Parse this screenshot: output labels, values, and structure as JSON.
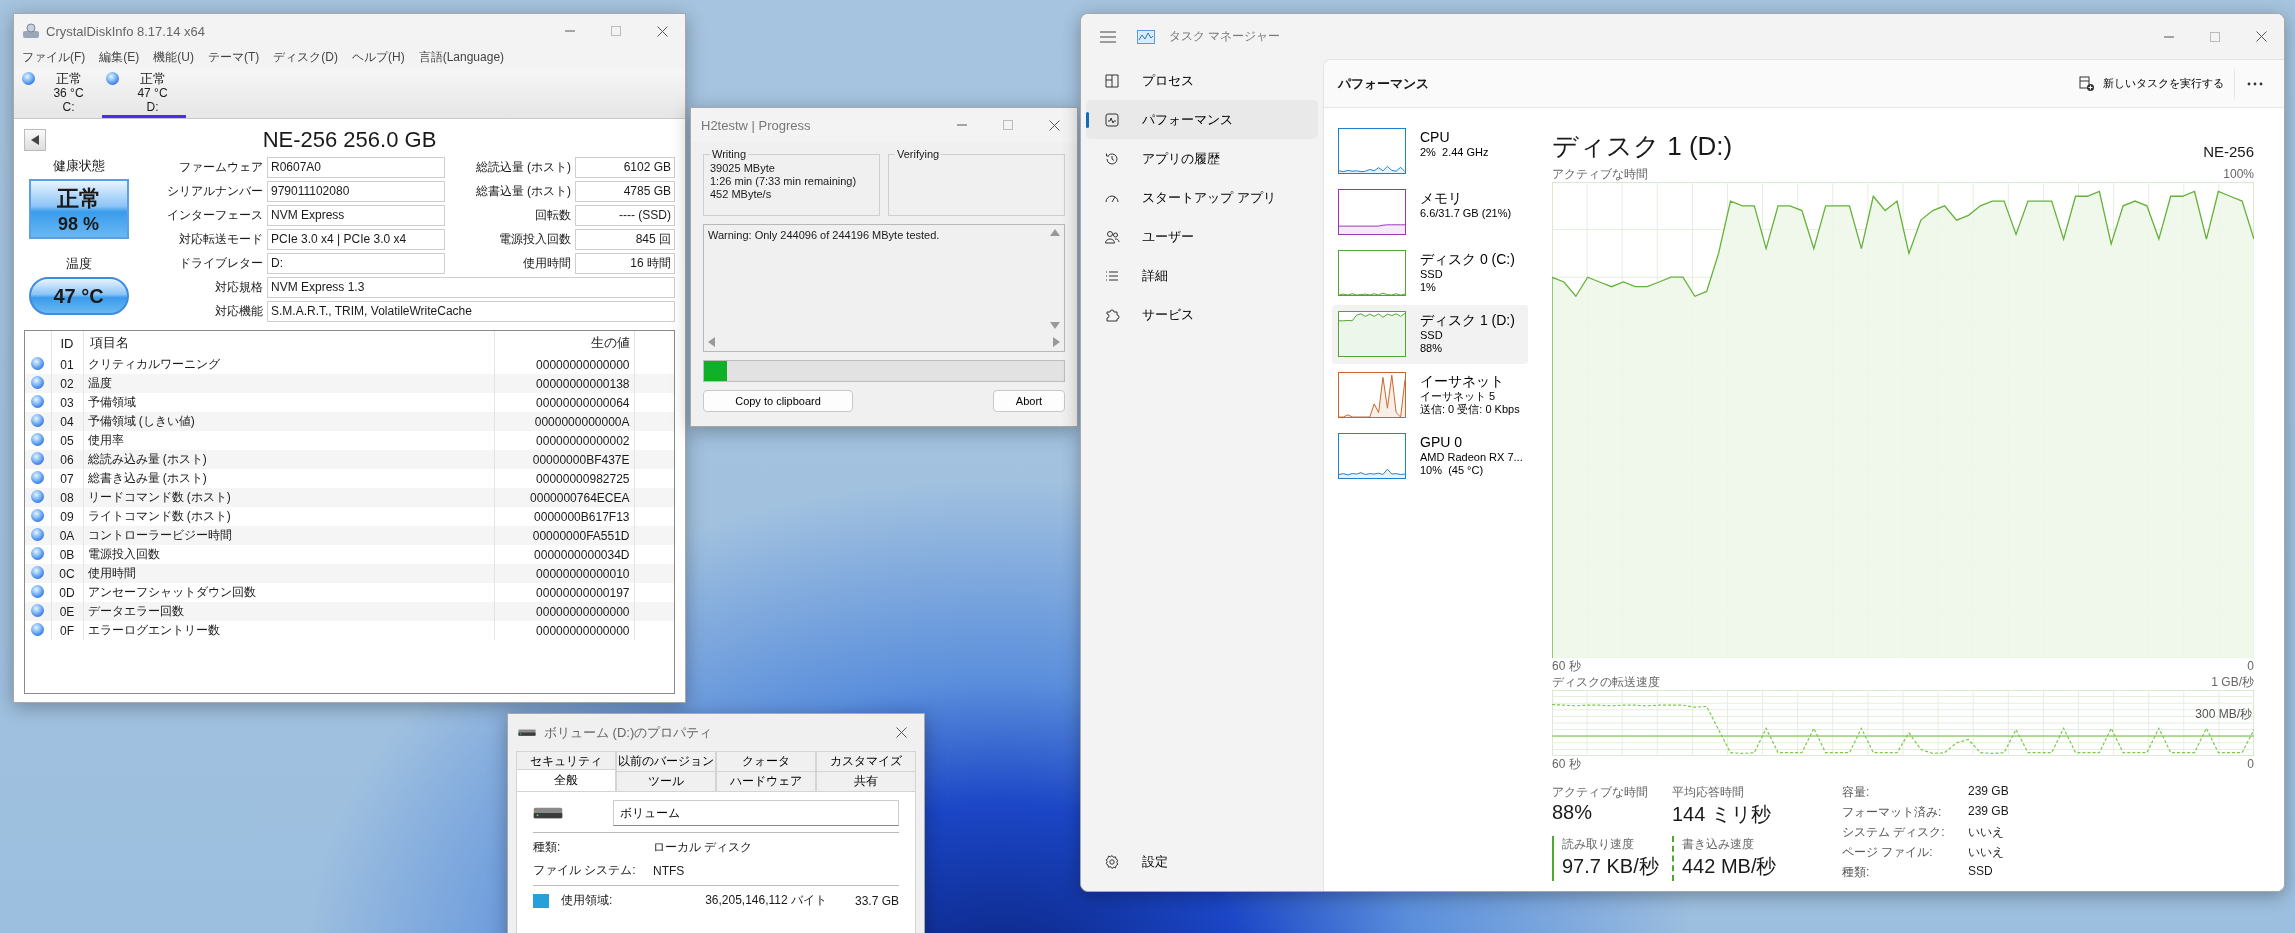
{
  "crystaldiskinfo": {
    "title": "CrystalDiskInfo 8.17.14 x64",
    "menu": [
      "ファイル(F)",
      "編集(E)",
      "機能(U)",
      "テーマ(T)",
      "ディスク(D)",
      "ヘルプ(H)",
      "言語(Language)"
    ],
    "drives": [
      {
        "status": "正常",
        "temperature": "36 °C",
        "letter": "C:",
        "selected": false
      },
      {
        "status": "正常",
        "temperature": "47 °C",
        "letter": "D:",
        "selected": true
      }
    ],
    "model": "NE-256 256.0 GB",
    "health": {
      "label": "健康状態",
      "status": "正常",
      "percent": "98 %"
    },
    "temperature": {
      "label": "温度",
      "value": "47 °C"
    },
    "info": [
      {
        "label": "ファームウェア",
        "value": "R0607A0",
        "right_label": "総読込量 (ホスト)",
        "right_value": "6102 GB"
      },
      {
        "label": "シリアルナンバー",
        "value": "979011102080",
        "right_label": "総書込量 (ホスト)",
        "right_value": "4785 GB"
      },
      {
        "label": "インターフェース",
        "value": "NVM Express",
        "right_label": "回転数",
        "right_value": "---- (SSD)"
      },
      {
        "label": "対応転送モード",
        "value": "PCIe 3.0 x4 | PCIe 3.0 x4",
        "right_label": "電源投入回数",
        "right_value": "845 回"
      },
      {
        "label": "ドライブレター",
        "value": "D:",
        "right_label": "使用時間",
        "right_value": "16 時間"
      }
    ],
    "info_wide": [
      {
        "label": "対応規格",
        "value": "NVM Express 1.3"
      },
      {
        "label": "対応機能",
        "value": "S.M.A.R.T., TRIM, VolatileWriteCache"
      }
    ],
    "smart": {
      "columns": [
        "ID",
        "項目名",
        "生の値"
      ],
      "rows": [
        {
          "id": "01",
          "name": "クリティカルワーニング",
          "raw": "00000000000000"
        },
        {
          "id": "02",
          "name": "温度",
          "raw": "00000000000138"
        },
        {
          "id": "03",
          "name": "予備領域",
          "raw": "00000000000064"
        },
        {
          "id": "04",
          "name": "予備領域 (しきい値)",
          "raw": "0000000000000A"
        },
        {
          "id": "05",
          "name": "使用率",
          "raw": "00000000000002"
        },
        {
          "id": "06",
          "name": "総読み込み量 (ホスト)",
          "raw": "00000000BF437E"
        },
        {
          "id": "07",
          "name": "総書き込み量 (ホスト)",
          "raw": "00000000982725"
        },
        {
          "id": "08",
          "name": "リードコマンド数 (ホスト)",
          "raw": "0000000764ECEA"
        },
        {
          "id": "09",
          "name": "ライトコマンド数 (ホスト)",
          "raw": "0000000B617F13"
        },
        {
          "id": "0A",
          "name": "コントローラービジー時間",
          "raw": "00000000FA551D"
        },
        {
          "id": "0B",
          "name": "電源投入回数",
          "raw": "0000000000034D"
        },
        {
          "id": "0C",
          "name": "使用時間",
          "raw": "00000000000010"
        },
        {
          "id": "0D",
          "name": "アンセーフシャットダウン回数",
          "raw": "00000000000197"
        },
        {
          "id": "0E",
          "name": "データエラー回数",
          "raw": "00000000000000"
        },
        {
          "id": "0F",
          "name": "エラーログエントリー数",
          "raw": "00000000000000"
        }
      ]
    }
  },
  "h2testw": {
    "title": "H2testw | Progress",
    "writing": {
      "label": "Writing",
      "lines": [
        "39025 MByte",
        "1:26 min (7:33 min remaining)",
        "452 MByte/s"
      ]
    },
    "verifying": {
      "label": "Verifying"
    },
    "log": "Warning: Only 244096 of 244196 MByte tested.",
    "progress": {
      "level": 0.065
    },
    "buttons": [
      "Copy to clipboard",
      "Abort"
    ]
  },
  "properties": {
    "title": "ボリューム (D:)のプロパティ",
    "tabs_back": [
      {
        "label": "セキュリティ",
        "selected": false
      },
      {
        "label": "以前のバージョン",
        "selected": false
      },
      {
        "label": "クォータ",
        "selected": false
      },
      {
        "label": "カスタマイズ",
        "selected": false
      }
    ],
    "tabs_front": [
      {
        "label": "全般",
        "selected": true
      },
      {
        "label": "ツール",
        "selected": false
      },
      {
        "label": "ハードウェア",
        "selected": false
      },
      {
        "label": "共有",
        "selected": false
      }
    ],
    "name": "ボリューム",
    "fields": [
      {
        "label": "種類:",
        "value": "ローカル ディスク"
      },
      {
        "label": "ファイル システム:",
        "value": "NTFS"
      }
    ],
    "used": {
      "label": "使用領域:",
      "bytes": "36,205,146,112 バイト",
      "size": "33.7 GB"
    }
  },
  "task_manager": {
    "title": "タスク マネージャー",
    "nav": [
      {
        "label": "プロセス",
        "selected": false
      },
      {
        "label": "パフォーマンス",
        "selected": true
      },
      {
        "label": "アプリの履歴",
        "selected": false
      },
      {
        "label": "スタートアップ アプリ",
        "selected": false
      },
      {
        "label": "ユーザー",
        "selected": false
      },
      {
        "label": "詳細",
        "selected": false
      },
      {
        "label": "サービス",
        "selected": false
      }
    ],
    "settings": "設定",
    "section_title": "パフォーマンス",
    "run_task": "新しいタスクを実行する",
    "devices": [
      {
        "name": "CPU",
        "lines": [
          "2%  2.44 GHz"
        ],
        "color": "#1f7fcf",
        "selected": false
      },
      {
        "name": "メモリ",
        "lines": [
          "6.6/31.7 GB (21%)"
        ],
        "color": "#9b34b8",
        "selected": false
      },
      {
        "name": "ディスク 0 (C:)",
        "lines": [
          "SSD",
          "1%"
        ],
        "color": "#4ea72e",
        "selected": false
      },
      {
        "name": "ディスク 1 (D:)",
        "lines": [
          "SSD",
          "88%"
        ],
        "color": "#4ea72e",
        "selected": true
      },
      {
        "name": "イーサネット",
        "lines": [
          "イーサネット 5",
          "送信: 0 受信: 0 Kbps"
        ],
        "color": "#c8662c",
        "selected": false
      },
      {
        "name": "GPU 0",
        "lines": [
          "AMD Radeon RX 7...",
          "10%  (45 °C)"
        ],
        "color": "#1f7fcf",
        "selected": false
      }
    ],
    "detail": {
      "title": "ディスク 1 (D:)",
      "model": "NE-256",
      "active_graph": {
        "label": "アクティブな時間",
        "max": "100%",
        "x_start": "60 秒",
        "x_end": "0"
      },
      "transfer_graph": {
        "label": "ディスクの転送速度",
        "max": "1 GB/秒",
        "reference": "300 MB/秒",
        "x_start": "60 秒",
        "x_end": "0"
      },
      "stats": [
        {
          "label": "アクティブな時間",
          "value": "88%"
        },
        {
          "label": "平均応答時間",
          "value": "144 ミリ秒"
        }
      ],
      "speeds": [
        {
          "label": "読み取り速度",
          "value": "97.7 KB/秒",
          "kind": "read"
        },
        {
          "label": "書き込み速度",
          "value": "442 MB/秒",
          "kind": "write"
        }
      ],
      "properties": [
        {
          "label": "容量:",
          "value": "239 GB"
        },
        {
          "label": "フォーマット済み:",
          "value": "239 GB"
        },
        {
          "label": "システム ディスク:",
          "value": "いいえ"
        },
        {
          "label": "ページ ファイル:",
          "value": "いいえ"
        },
        {
          "label": "種類:",
          "value": "SSD"
        }
      ]
    }
  }
}
